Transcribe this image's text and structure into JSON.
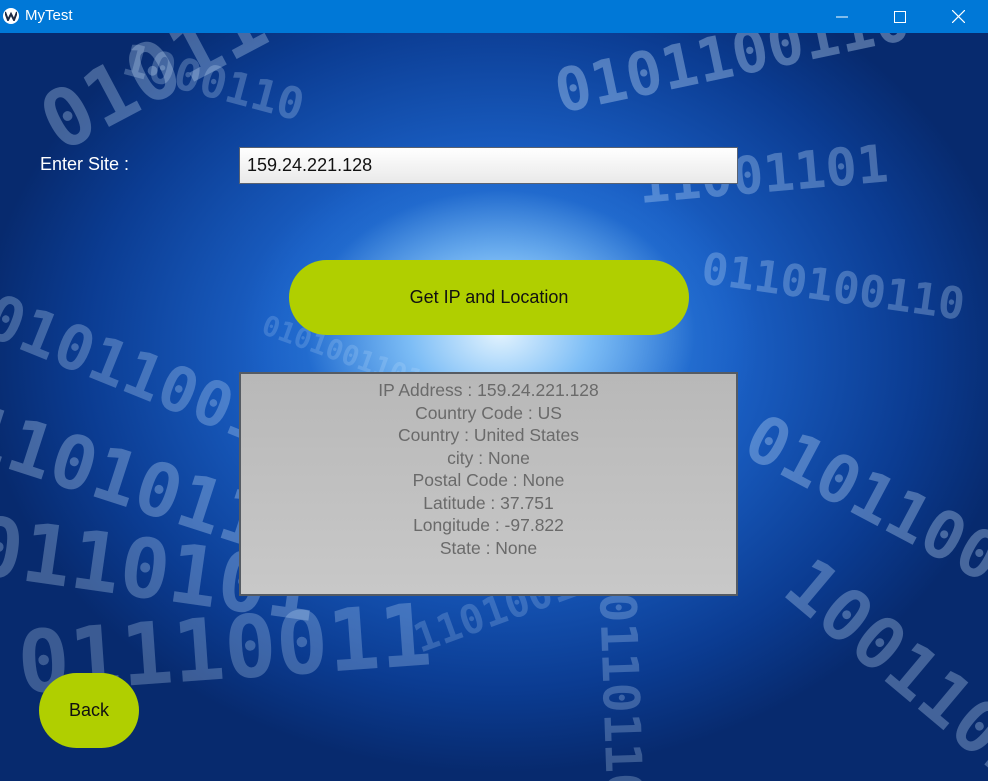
{
  "window": {
    "title": "MyTest",
    "icons": {
      "app": "kivy-app-icon",
      "minimize": "minimize-icon",
      "maximize": "maximize-icon",
      "close": "close-icon"
    }
  },
  "form": {
    "site_label": "Enter Site :",
    "site_value": "159.24.221.128",
    "get_button_label": "Get IP and Location"
  },
  "result": {
    "lines": [
      "IP Address : 159.24.221.128",
      "Country Code : US",
      "Country : United States",
      "city : None",
      "Postal Code : None",
      "Latitude : 37.751",
      "Longitude : -97.822",
      "State : None"
    ]
  },
  "back_button_label": "Back",
  "colors": {
    "titlebar": "#0078d7",
    "accent_button": "#b0cf00",
    "result_background": "#bdbdbd",
    "result_text": "#6a6a6a",
    "background": "#1a5fc4"
  }
}
